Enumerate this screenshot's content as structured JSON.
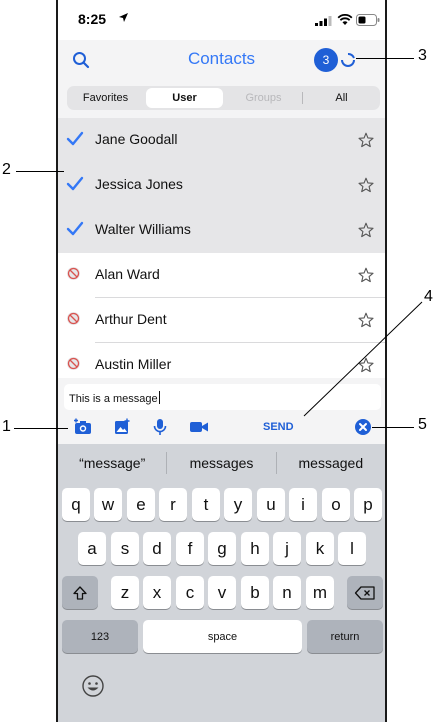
{
  "status_bar": {
    "time": "8:25"
  },
  "header": {
    "title": "Contacts",
    "badge_count": "3"
  },
  "segments": [
    {
      "label": "Favorites",
      "state": "normal"
    },
    {
      "label": "User",
      "state": "selected"
    },
    {
      "label": "Groups",
      "state": "disabled"
    },
    {
      "label": "All",
      "state": "normal"
    }
  ],
  "contacts": [
    {
      "name": "Jane Goodall",
      "selected": true
    },
    {
      "name": "Jessica Jones",
      "selected": true
    },
    {
      "name": "Walter Williams",
      "selected": true
    },
    {
      "name": "Alan Ward",
      "selected": false
    },
    {
      "name": "Arthur Dent",
      "selected": false
    },
    {
      "name": "Austin Miller",
      "selected": false
    }
  ],
  "composer": {
    "message": "This is a message",
    "send_label": "SEND"
  },
  "keyboard": {
    "suggestions": [
      "“message”",
      "messages",
      "messaged"
    ],
    "row1": [
      "q",
      "w",
      "e",
      "r",
      "t",
      "y",
      "u",
      "i",
      "o",
      "p"
    ],
    "row2": [
      "a",
      "s",
      "d",
      "f",
      "g",
      "h",
      "j",
      "k",
      "l"
    ],
    "row3": [
      "z",
      "x",
      "c",
      "v",
      "b",
      "n",
      "m"
    ],
    "numbers_label": "123",
    "space_label": "space",
    "return_label": "return"
  },
  "callouts": [
    "1",
    "2",
    "3",
    "4",
    "5"
  ],
  "colors": {
    "accent": "#3478f6",
    "badge": "#1f5fd6",
    "keyboard_bg": "#d1d4d9"
  }
}
